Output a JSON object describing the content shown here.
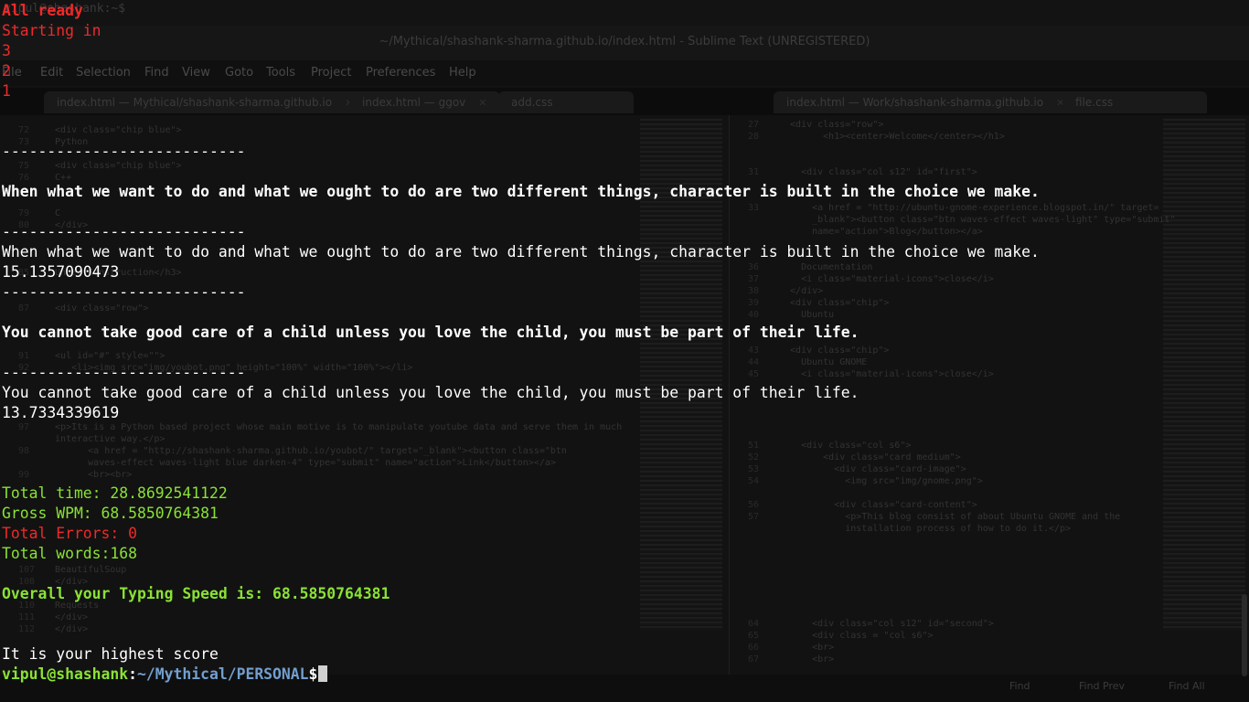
{
  "background": {
    "top_prompt": "vipul@shashank:~$",
    "sublime": {
      "window_title": "~/Mythical/shashank-sharma.github.io/index.html - Sublime Text (UNREGISTERED)",
      "menu": [
        "File",
        "Edit",
        "Selection",
        "Find",
        "View",
        "Goto",
        "Tools",
        "Project",
        "Preferences",
        "Help"
      ],
      "tabs_left": [
        "index.html — Mythical/shashank-sharma.github.io",
        "index.html — ggov",
        "add.css"
      ],
      "tabs_right": [
        "index.html — Work/shashank-sharma.github.io",
        "file.css"
      ],
      "left_code": [
        {
          "n": "72",
          "t": "  <div class=\"chip blue\">"
        },
        {
          "n": "73",
          "t": "  Python"
        },
        {
          "n": "75",
          "t": "  <div class=\"chip blue\">"
        },
        {
          "n": "76",
          "t": "  C++"
        },
        {
          "n": "79",
          "t": "  C"
        },
        {
          "n": "80",
          "t": "  </div>"
        },
        {
          "n": "85",
          "t": "  Under Construction</h3>"
        },
        {
          "n": "87",
          "t": "  <div class=\"row\">"
        },
        {
          "n": "91",
          "t": "  <ul id=\"#\" style=\"\">"
        },
        {
          "n": "92",
          "t": "     <li><img src=\"img/youbot.png\" height=\"100%\" width=\"100%\"></li>"
        },
        {
          "n": "97",
          "t": "  <p>Its is a Python based project whose main motive is to manipulate youtube data and serve them in much"
        },
        {
          "n": "",
          "t": "  interactive way.</p>"
        },
        {
          "n": "98",
          "t": "        <a href = \"http://shashank-sharma.github.io/youbot/\" target=\"_blank\"><button class=\"btn"
        },
        {
          "n": "",
          "t": "        waves-effect waves-light blue darken-4\" type=\"submit\" name=\"action\">Link</button></a>"
        },
        {
          "n": "99",
          "t": "        <br><br>"
        },
        {
          "n": "107",
          "t": "  BeautifulSoup"
        },
        {
          "n": "108",
          "t": "  </div>"
        },
        {
          "n": "110",
          "t": "  Requests"
        },
        {
          "n": "111",
          "t": "  </div>"
        },
        {
          "n": "112",
          "t": "  </div>"
        }
      ],
      "right_code": [
        {
          "n": "27",
          "t": "  <div class=\"row\">"
        },
        {
          "n": "28",
          "t": "        <h1><center>Welcome</center></h1>"
        },
        {
          "n": "31",
          "t": "    <div class=\"col s12\" id=\"first\">"
        },
        {
          "n": "33",
          "t": "      <a href = \"http://ubuntu-gnome-experience.blogspot.in/\" target="
        },
        {
          "n": "",
          "t": "      _blank\"><button class=\"btn waves-effect waves-light\" type=\"submit\""
        },
        {
          "n": "",
          "t": "      name=\"action\">Blog</button></a>"
        },
        {
          "n": "36",
          "t": "    Documentation"
        },
        {
          "n": "37",
          "t": "    <i class=\"material-icons\">close</i>"
        },
        {
          "n": "38",
          "t": "  </div>"
        },
        {
          "n": "39",
          "t": "  <div class=\"chip\">"
        },
        {
          "n": "40",
          "t": "    Ubuntu"
        },
        {
          "n": "43",
          "t": "  <div class=\"chip\">"
        },
        {
          "n": "44",
          "t": "    Ubuntu GNOME"
        },
        {
          "n": "45",
          "t": "    <i class=\"material-icons\">close</i>"
        },
        {
          "n": "51",
          "t": "    <div class=\"col s6\">"
        },
        {
          "n": "52",
          "t": "        <div class=\"card medium\">"
        },
        {
          "n": "53",
          "t": "          <div class=\"card-image\">"
        },
        {
          "n": "54",
          "t": "            <img src=\"img/gnome.png\">"
        },
        {
          "n": "56",
          "t": "          <div class=\"card-content\">"
        },
        {
          "n": "57",
          "t": "            <p>This blog consist of about Ubuntu GNOME and the"
        },
        {
          "n": "",
          "t": "            installation process of how to do it.</p>"
        },
        {
          "n": "64",
          "t": "      <div class=\"col s12\" id=\"second\">"
        },
        {
          "n": "65",
          "t": "      <div class = \"col s6\">"
        },
        {
          "n": "66",
          "t": "      <br>"
        },
        {
          "n": "67",
          "t": "      <br>"
        }
      ],
      "find_buttons": [
        "Find",
        "Find Prev",
        "Find All"
      ]
    }
  },
  "terminal": {
    "all_ready": "All ready",
    "starting_in": "Starting in",
    "countdown": [
      "3",
      "2",
      "1"
    ],
    "separator": "---------------------------",
    "quote1_prompt": "When what we want to do and what we ought to do are two different things, character is built in the choice we make.",
    "quote1_typed": "When what we want to do and what we ought to do are two different things, character is built in the choice we make.",
    "quote1_time": "15.1357090473",
    "quote2_prompt": "You cannot take good care of a child unless you love the child, you must be part of their life.",
    "quote2_typed": "You cannot take good care of a child unless you love the child, you must be part of their life.",
    "quote2_time": "13.7334339619",
    "total_time": "Total time: 28.8692541122",
    "gross_wpm": "Gross WPM: 68.5850764381",
    "total_errors": "Total Errors: 0",
    "total_words": "Total words:168",
    "overall_speed": "Overall your Typing Speed is: 68.5850764381",
    "highest_score": "It is your highest score",
    "prompt_user": "vipul@shashank",
    "prompt_sep": ":",
    "prompt_path": "~/Mythical/PERSONAL",
    "prompt_symbol": "$"
  },
  "colors": {
    "red": "#ef2929",
    "green": "#8ae234",
    "blue": "#729fcf",
    "white": "#ffffff",
    "background": "#000000"
  }
}
